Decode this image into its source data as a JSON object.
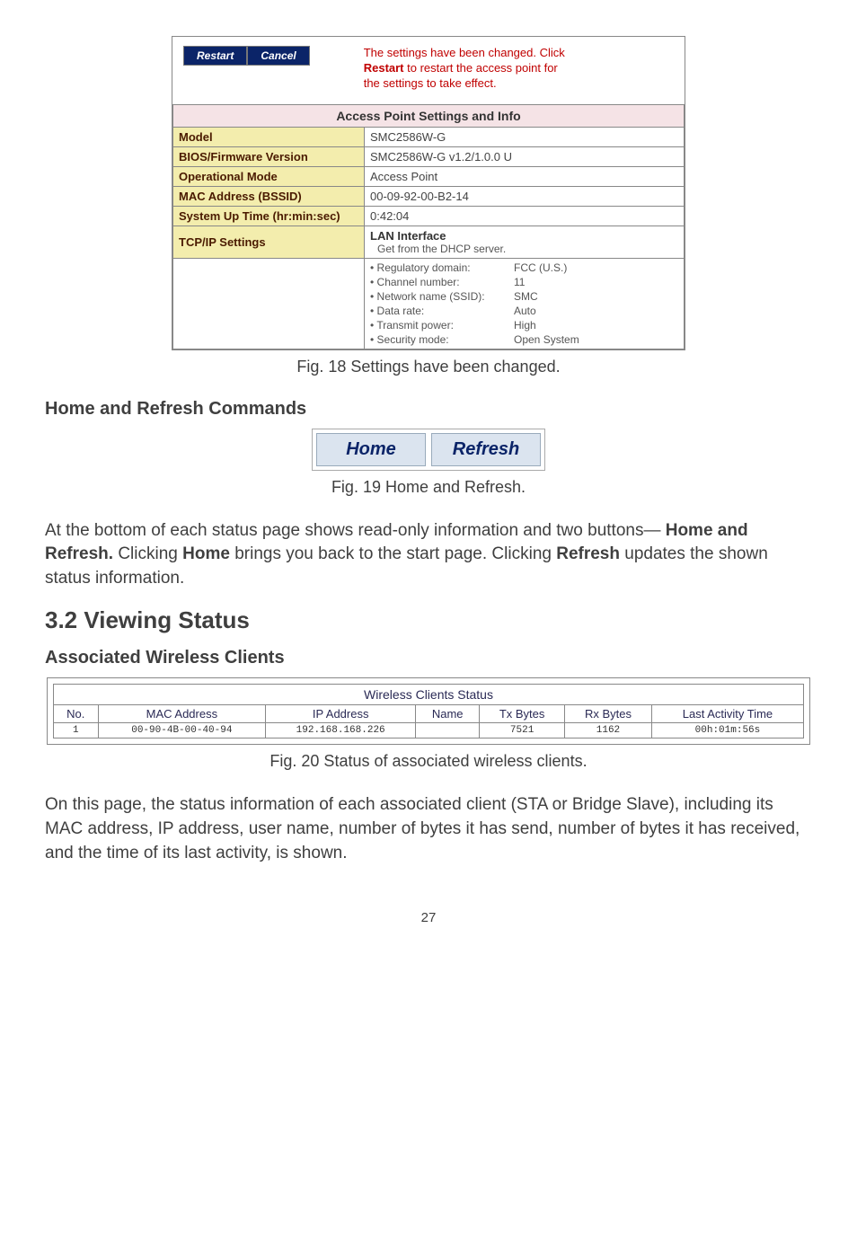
{
  "fig18": {
    "buttons": {
      "restart": "Restart",
      "cancel": "Cancel"
    },
    "notice": {
      "line1": "The settings have been changed. Click",
      "bold": "Restart",
      "line2_rest": " to restart the access point for",
      "line3": "the settings to take effect."
    },
    "title": "Access Point Settings and Info",
    "rows": {
      "model_label": "Model",
      "model_value": "SMC2586W-G",
      "bios_label": "BIOS/Firmware Version",
      "bios_value": "SMC2586W-G v1.2/1.0.0 U",
      "mode_label": "Operational Mode",
      "mode_value": "Access Point",
      "mac_label": "MAC Address (BSSID)",
      "mac_value": "00-09-92-00-B2-14",
      "uptime_label": "System Up Time (hr:min:sec)",
      "uptime_value": "0:42:04",
      "tcpip_label": "TCP/IP Settings",
      "lan_title": "LAN Interface",
      "lan_sub": "Get from the DHCP server.",
      "items": {
        "reg_k": "Regulatory domain:",
        "reg_v": "FCC (U.S.)",
        "ch_k": "Channel number:",
        "ch_v": "11",
        "ssid_k": "Network name (SSID):",
        "ssid_v": "SMC",
        "rate_k": "Data rate:",
        "rate_v": "Auto",
        "tx_k": "Transmit power:",
        "tx_v": "High",
        "sec_k": "Security mode:",
        "sec_v": "Open System"
      }
    },
    "caption": "Fig. 18 Settings have been changed."
  },
  "section_hr": {
    "heading": "Home and Refresh Commands",
    "home": "Home",
    "refresh": "Refresh",
    "caption": "Fig. 19 Home and Refresh.",
    "para_pre": "At the bottom of each status page shows read-only information and two buttons—",
    "para_bold1": "Home and Refresh.",
    "para_mid1": " Clicking ",
    "para_bold2": "Home",
    "para_mid2": " brings you back to the start page. Clicking ",
    "para_bold3": "Refresh",
    "para_end": " updates the shown status information."
  },
  "section_vs": {
    "heading": "3.2 Viewing Status",
    "sub": "Associated Wireless Clients",
    "table_title": "Wireless Clients Status",
    "headers": {
      "no": "No.",
      "mac": "MAC Address",
      "ip": "IP Address",
      "name": "Name",
      "tx": "Tx Bytes",
      "rx": "Rx Bytes",
      "last": "Last Activity Time"
    },
    "row": {
      "no": "1",
      "mac": "00-90-4B-00-40-94",
      "ip": "192.168.168.226",
      "name": "",
      "tx": "7521",
      "rx": "1162",
      "last": "00h:01m:56s"
    },
    "caption": "Fig. 20 Status of associated wireless clients.",
    "para": "On this page, the status information of each associated client (STA or Bridge Slave), including its MAC address, IP address, user name, number of bytes it has send, number of bytes it has received, and the time of its last activity, is shown."
  },
  "page": "27"
}
